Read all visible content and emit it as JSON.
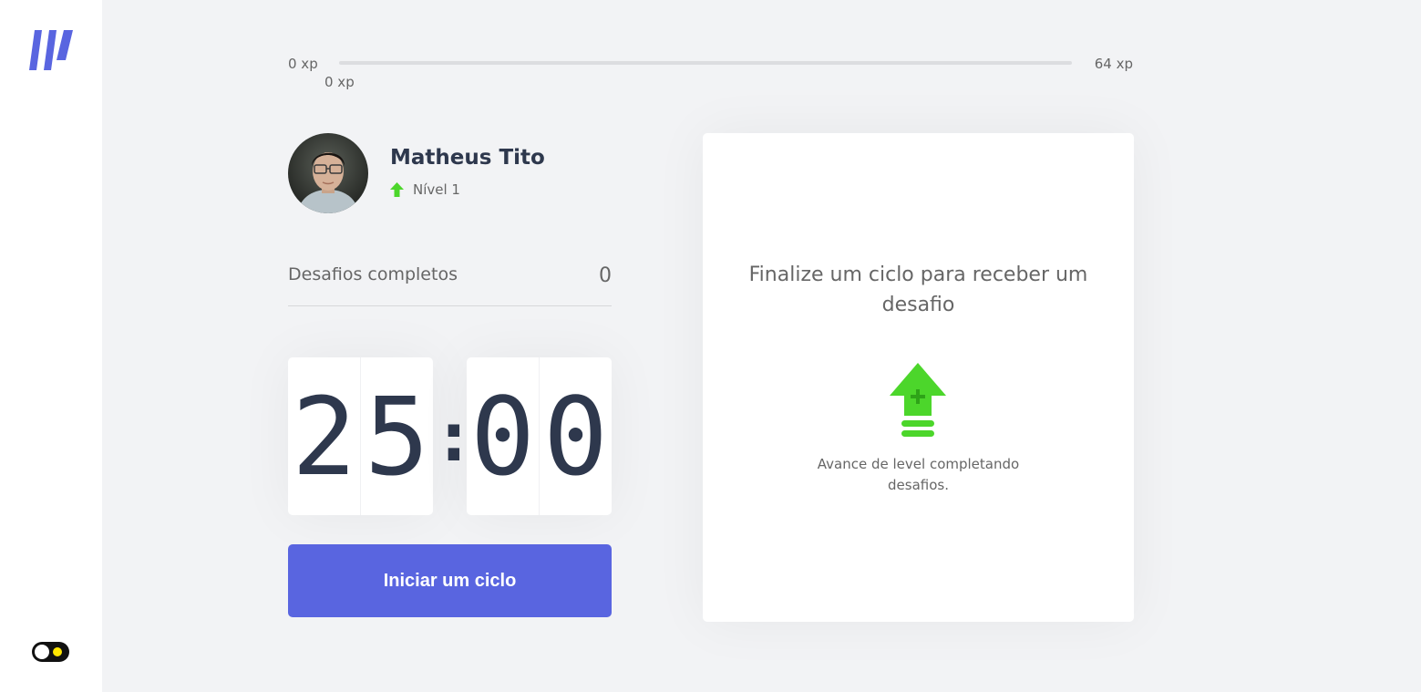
{
  "experience": {
    "min_label": "0 xp",
    "max_label": "64 xp",
    "current_label": "0 xp",
    "progress": 0,
    "bar_color": "#4cd62b"
  },
  "profile": {
    "name": "Matheus Tito",
    "level_label": "Nível 1",
    "level_icon": "level-up-arrow-icon"
  },
  "completed_challenges": {
    "label": "Desafios completos",
    "count": "0"
  },
  "countdown": {
    "minute_left": "2",
    "minute_right": "5",
    "separator": ":",
    "second_left": "0",
    "second_right": "0"
  },
  "start_button": {
    "label": "Iniciar um ciclo",
    "color": "#5965e0"
  },
  "challenge_box": {
    "title": "Finalize um ciclo para receber um desafio",
    "hint": "Avance de level completando desafios.",
    "icon": "level-up-icon"
  },
  "sidebar": {
    "logo_icon": "logo-icon",
    "theme_toggle_icon": "theme-toggle-icon"
  },
  "colors": {
    "accent": "#5965e0",
    "green": "#4cd62b",
    "title": "#2e384d",
    "text": "#666666",
    "background": "#f2f3f5"
  }
}
